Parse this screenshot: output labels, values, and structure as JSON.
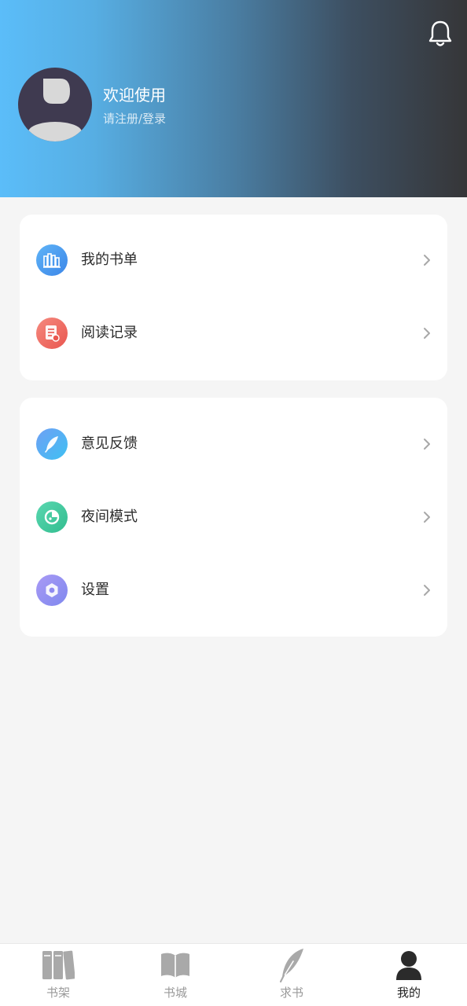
{
  "header": {
    "title": "欢迎使用",
    "subtitle": "请注册/登录",
    "notification_icon": "bell-icon",
    "avatar_icon": "default-avatar"
  },
  "menu_group_1": [
    {
      "label": "我的书单",
      "icon": "booklist-icon",
      "color": "#4c9cf0"
    },
    {
      "label": "阅读记录",
      "icon": "history-icon",
      "color": "#ef6b62"
    }
  ],
  "menu_group_2": [
    {
      "label": "意见反馈",
      "icon": "feather-icon",
      "color": "#4aa3f5"
    },
    {
      "label": "夜间模式",
      "icon": "pie-icon",
      "color": "#3fc99a"
    },
    {
      "label": "设置",
      "icon": "gear-icon",
      "color": "#8e86f2"
    }
  ],
  "tabbar": {
    "items": [
      {
        "label": "书架",
        "icon": "bookshelf-icon",
        "active": false
      },
      {
        "label": "书城",
        "icon": "open-book-icon",
        "active": false
      },
      {
        "label": "求书",
        "icon": "quill-icon",
        "active": false
      },
      {
        "label": "我的",
        "icon": "person-icon",
        "active": true
      }
    ]
  },
  "colors": {
    "header_gradient_start": "#5bbdf9",
    "header_gradient_end": "#363638",
    "page_background": "#f5f5f5",
    "tab_active": "#222222",
    "tab_inactive": "#9a9a9a"
  }
}
